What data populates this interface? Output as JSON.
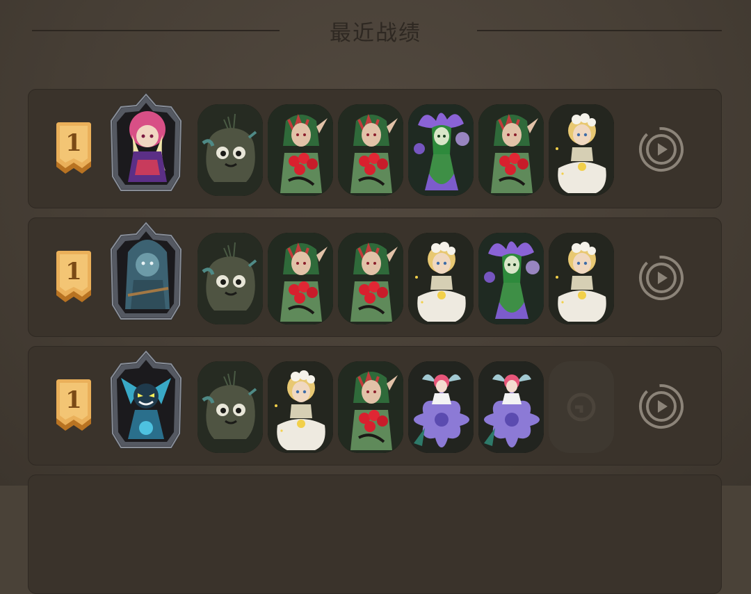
{
  "header": {
    "title": "最近战绩"
  },
  "colors": {
    "background": "#4a4238",
    "row": "#3a332b",
    "badge": "#e2a24a",
    "slot": "#1d1a16"
  },
  "matches": [
    {
      "rank": "1",
      "commander": "pink-mage-commander",
      "units": [
        "stone-golem",
        "rose-dryad",
        "rose-dryad",
        "violet-flower-sorceress",
        "rose-dryad",
        "white-lily-fairy"
      ]
    },
    {
      "rank": "1",
      "commander": "blue-hooded-witch-commander",
      "units": [
        "stone-golem",
        "rose-dryad",
        "rose-dryad",
        "white-lily-fairy",
        "violet-flower-sorceress",
        "white-lily-fairy"
      ]
    },
    {
      "rank": "1",
      "commander": "winged-cat-demon-commander",
      "units": [
        "stone-golem",
        "white-lily-fairy",
        "rose-dryad",
        "daisy-pixie",
        "daisy-pixie",
        "empty-slot"
      ]
    }
  ]
}
